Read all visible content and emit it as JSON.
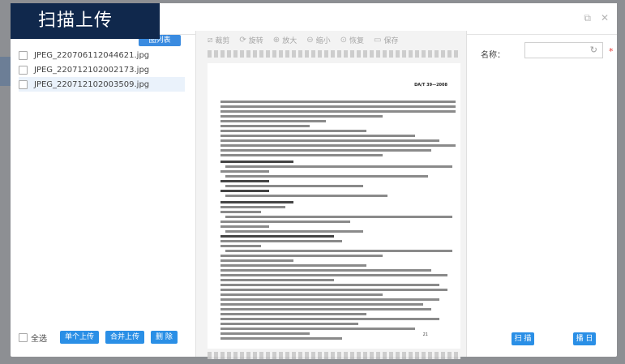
{
  "dialog": {
    "title": "扫描上传",
    "header_icons": [
      "restore-icon",
      "close-icon"
    ],
    "restore_glyph": "⧉",
    "close_glyph": "✕"
  },
  "left_panel": {
    "tab_label": "图列表",
    "files": [
      {
        "name": "JPEG_220706112044621.jpg",
        "selected": false
      },
      {
        "name": "JPEG_220712102002173.jpg",
        "selected": false
      },
      {
        "name": "JPEG_220712102003509.jpg",
        "selected": true
      }
    ],
    "select_all_label": "全选",
    "buttons": {
      "single_upload": "单个上传",
      "merge_upload": "合并上传",
      "delete": "删 除"
    }
  },
  "viewer": {
    "tools": [
      {
        "icon": "crop-icon",
        "glyph": "⧄",
        "label": "裁剪"
      },
      {
        "icon": "rotate-icon",
        "glyph": "⟳",
        "label": "旋转"
      },
      {
        "icon": "zoom-in-icon",
        "glyph": "⊕",
        "label": "放大"
      },
      {
        "icon": "zoom-out-icon",
        "glyph": "⊖",
        "label": "缩小"
      },
      {
        "icon": "restore-icon",
        "glyph": "⊙",
        "label": "恢复"
      },
      {
        "icon": "save-icon",
        "glyph": "▭",
        "label": "保存"
      }
    ],
    "document": {
      "code": "DA/T 39—2008",
      "page_number": "21"
    }
  },
  "right_panel": {
    "name_label": "名称：",
    "name_value": "",
    "required_mark": "*",
    "refresh_glyph": "↻",
    "scan_label": "扫 描",
    "scan_label_2": "播 日"
  }
}
